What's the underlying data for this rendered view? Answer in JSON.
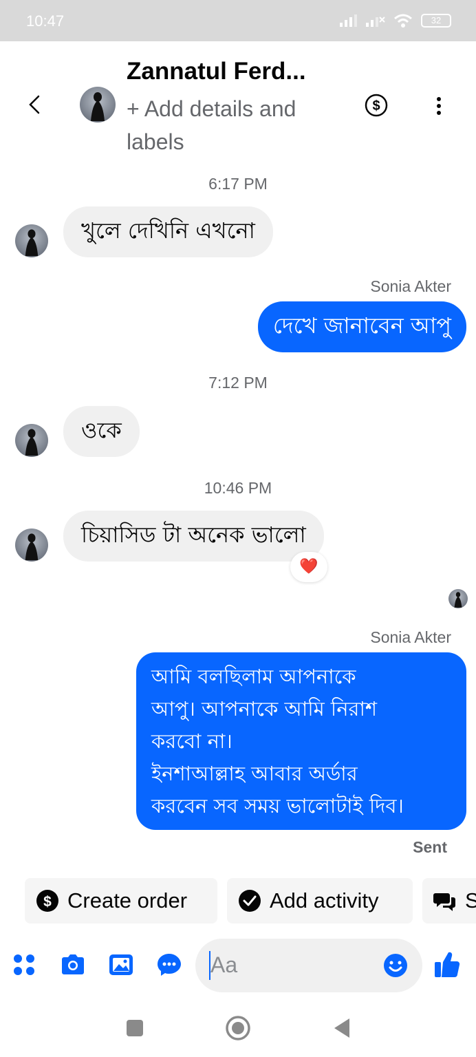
{
  "status_bar": {
    "time": "10:47",
    "battery": "32"
  },
  "header": {
    "contact_name": "Zannatul Ferd...",
    "subtitle": "+ Add details and labels"
  },
  "messages": {
    "ts1": "6:17 PM",
    "msg1": "খুলে দেখিনি এখনো",
    "sender1": "Sonia Akter",
    "msg2": "দেখে জানাবেন আপু",
    "ts2": "7:12 PM",
    "msg3": "ওকে",
    "ts3": "10:46 PM",
    "msg4": "চিয়াসিড টা অনেক ভালো",
    "reaction": "❤️",
    "sender2": "Sonia Akter",
    "msg5_lines": [
      "আমি বলছিলাম আপনাকে",
      "আপু। আপনাকে আমি নিরাশ",
      "করবো না।",
      "ইনশাআল্লাহ আবার অর্ডার",
      "করবেন সব সময় ভালোটাই দিব।"
    ],
    "status": "Sent"
  },
  "chips": {
    "create_order": "Create order",
    "add_activity": "Add activity",
    "third": "S"
  },
  "composer": {
    "placeholder": "Aa"
  },
  "colors": {
    "accent": "#0866ff",
    "incoming_bg": "#f0f0f0",
    "muted": "#65676b"
  },
  "icons": [
    "back-icon",
    "dollar-circle-icon",
    "more-vertical-icon",
    "menu-dots-icon",
    "camera-icon",
    "image-icon",
    "chat-bubble-icon",
    "emoji-icon",
    "thumbs-up-icon",
    "check-circle-icon",
    "quick-reply-icon"
  ]
}
